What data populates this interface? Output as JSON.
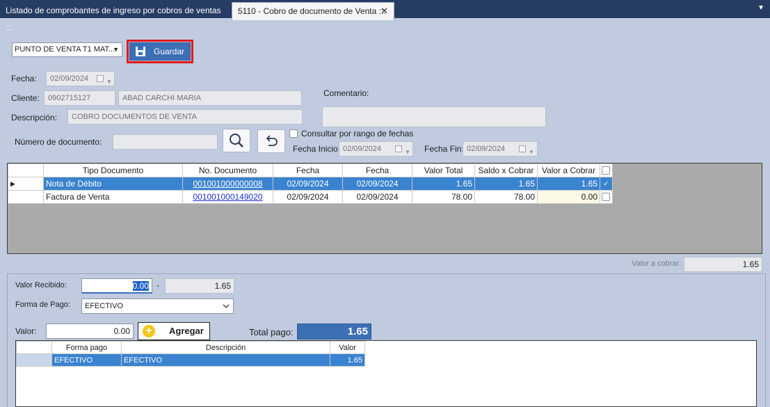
{
  "tabs": [
    {
      "label": "Listado de comprobantes de ingreso por cobros de ventas ::."
    },
    {
      "label": "5110 - Cobro de documento de Venta ::."
    }
  ],
  "tab_close": "✕",
  "tab_menu": "▼",
  "toolbar": {
    "punto_venta": "PUNTO DE VENTA T1 MAT...",
    "save_label": "Guardar"
  },
  "form": {
    "fecha_label": "Fecha:",
    "fecha_value": "02/09/2024",
    "cliente_label": "Cliente:",
    "cliente_id": "0902715127",
    "cliente_nombre": "ABAD CARCHI MARIA",
    "descripcion_label": "Descripción:",
    "descripcion_value": "COBRO DOCUMENTOS DE VENTA",
    "comentario_label": "Comentario:",
    "comentario_value": "",
    "numero_doc_label": "Número de documento:",
    "numero_doc_value": "",
    "rango_label": "Consultar por rango de fechas",
    "fecha_inicio_label": "Fecha Inicio:",
    "fecha_inicio_value": "02/09/2024",
    "fecha_fin_label": "Fecha Fin:",
    "fecha_fin_value": "02/09/2024"
  },
  "documents": {
    "columns": [
      "Tipo Documento",
      "No. Documento",
      "Fecha",
      "Fecha",
      "Valor Total",
      "Saldo x Cobrar",
      "Valor a Cobrar"
    ],
    "rows": [
      {
        "tipo": "Nota de Débito",
        "numero": "001001000000008",
        "fecha1": "02/09/2024",
        "fecha2": "02/09/2024",
        "total": "1.65",
        "saldo": "1.65",
        "cobrar": "1.65",
        "checked": true,
        "selected": true
      },
      {
        "tipo": "Factura de Venta",
        "numero": "001001000149020",
        "fecha1": "02/09/2024",
        "fecha2": "02/09/2024",
        "total": "78.00",
        "saldo": "78.00",
        "cobrar": "0.00",
        "checked": false,
        "selected": false
      }
    ]
  },
  "valor_a_cobrar_label": "Valor a cobrar:",
  "valor_a_cobrar_value": "1.65",
  "payment": {
    "valor_recibido_label": "Valor Recibido:",
    "valor_recibido_value": "0.00",
    "minus": "-",
    "diferencia_value": "1.65",
    "forma_pago_label": "Forma de Pago:",
    "forma_pago_value": "EFECTIVO",
    "valor_label": "Valor:",
    "valor_value": "0.00",
    "agregar_label": "Agregar",
    "total_pago_label": "Total pago:",
    "total_pago_value": "1.65"
  },
  "payments_grid": {
    "columns": [
      "Forma pago",
      "Descripción",
      "Valor"
    ],
    "rows": [
      {
        "forma": "EFECTIVO",
        "descripcion": "EFECTIVO",
        "valor": "1.65"
      }
    ]
  }
}
